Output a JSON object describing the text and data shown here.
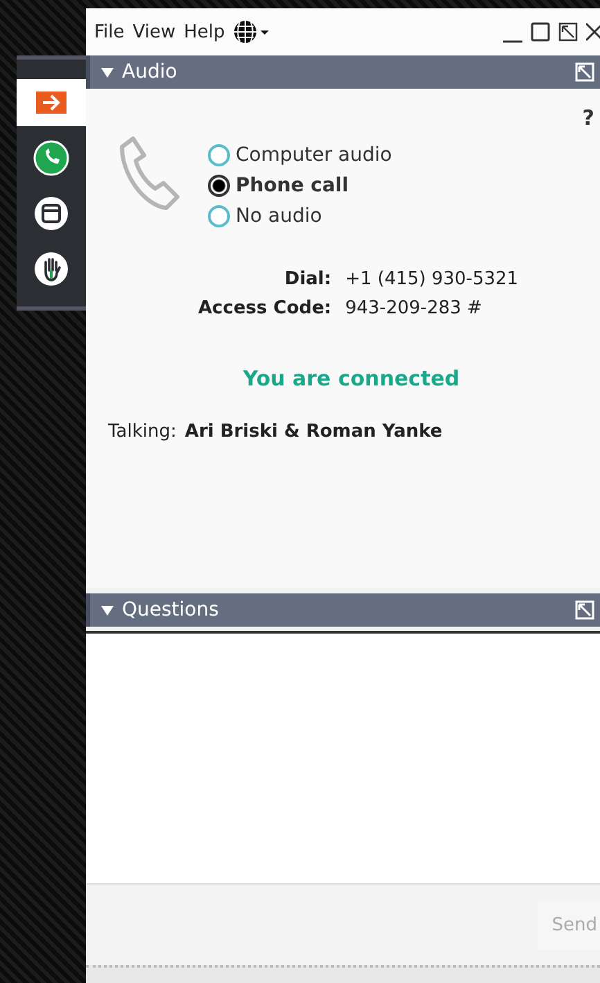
{
  "menu": [
    "File",
    "View",
    "Help"
  ],
  "sidebar": [
    {
      "kind": "arrow",
      "selected": true
    },
    {
      "kind": "phone",
      "selected": false
    },
    {
      "kind": "window",
      "selected": false
    },
    {
      "kind": "hand",
      "selected": false
    }
  ],
  "audio": {
    "title": "Audio",
    "expanded": true,
    "help": "?",
    "options": [
      {
        "label": "Computer audio",
        "selected": false
      },
      {
        "label": "Phone call",
        "selected": true
      },
      {
        "label": "No audio",
        "selected": false
      }
    ],
    "dial_label": "Dial:",
    "dial_value": "+1 (415) 930-5321",
    "code_label": "Access Code:",
    "code_value": "943-209-283 #",
    "status": "You are connected",
    "talking_label": "Talking:",
    "talking_value": "Ari Briski & Roman Yanke"
  },
  "questions": {
    "title": "Questions",
    "expanded": true,
    "send": "Send"
  }
}
